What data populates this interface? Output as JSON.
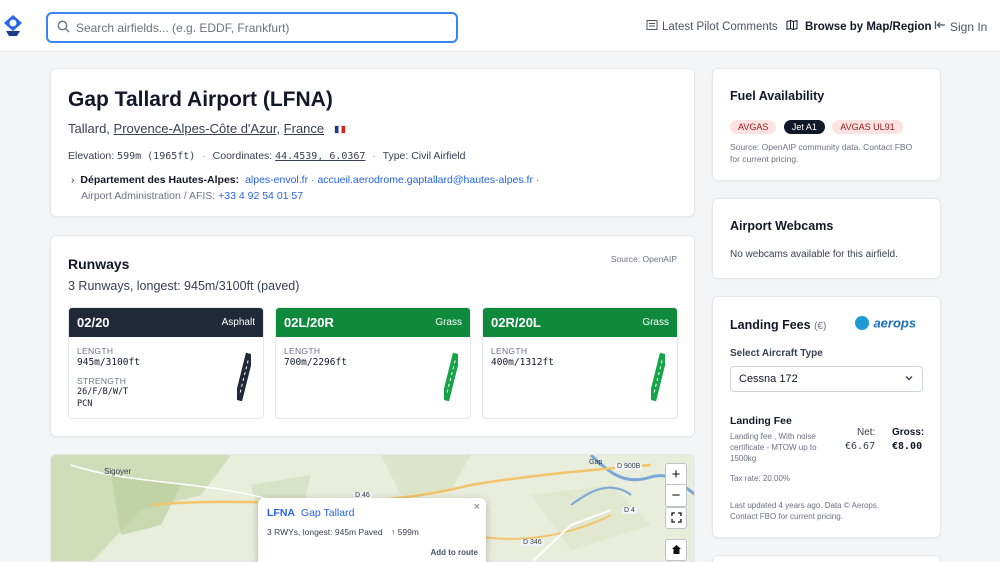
{
  "header": {
    "search_placeholder": "Search airfields... (e.g. EDDF, Frankfurt)",
    "latest_comments": "Latest Pilot Comments",
    "browse": "Browse by Map/Region",
    "sign_in": "Sign In"
  },
  "airport": {
    "title": "Gap Tallard Airport (LFNA)",
    "city": "Tallard",
    "region": "Provence-Alpes-Côte d'Azur",
    "country": "France",
    "elevation_label": "Elevation:",
    "elevation_value": "599m (1965ft)",
    "coordinates_label": "Coordinates:",
    "coordinates_value": "44.4539, 6.0367",
    "type_label": "Type:",
    "type_value": "Civil Airfield",
    "operator": "Département des Hautes-Alpes:",
    "website": "alpes-envol.fr",
    "email": "accueil.aerodrome.gaptallard@hautes-alpes.fr",
    "admin_label": "Airport Administration / AFIS:",
    "phone": "+33 4 92 54 01 57"
  },
  "runways": {
    "title": "Runways",
    "source": "Source: OpenAIP",
    "summary": "3 Runways, longest: 945m/3100ft (paved)",
    "length_label": "LENGTH",
    "strength_label": "STRENGTH",
    "items": [
      {
        "designator": "02/20",
        "surface": "Asphalt",
        "length": "945m/3100ft",
        "strength": "26/F/B/W/T",
        "pcn": "PCN",
        "color": "#1f2937"
      },
      {
        "designator": "02L/20R",
        "surface": "Grass",
        "length": "700m/2296ft",
        "color": "#0f8a3c"
      },
      {
        "designator": "02R/20L",
        "surface": "Grass",
        "length": "400m/1312ft",
        "color": "#0f8a3c"
      }
    ]
  },
  "fuel": {
    "title": "Fuel Availability",
    "badges": [
      "AVGAS",
      "Jet A1",
      "AVGAS UL91"
    ],
    "note_line1": "Source: OpenAIP community data. Contact FBO",
    "note_line2": "for current pricing."
  },
  "webcams": {
    "title": "Airport Webcams",
    "empty": "No webcams available for this airfield."
  },
  "fees": {
    "title": "Landing Fees",
    "currency": "(€)",
    "brand": "aerops",
    "aircraft_label": "Select Aircraft Type",
    "aircraft_value": "Cessna 172",
    "fee_title": "Landing Fee",
    "fee_desc_1": "Landing fee , With noise",
    "fee_desc_2": "certificate - MTOW up to",
    "fee_desc_3": "1500kg",
    "net_label": "Net:",
    "net_value": "€6.67",
    "gross_label": "Gross:",
    "gross_value": "€8.00",
    "tax": "Tax rate: 20.00%",
    "updated_1": "Last updated 4 years ago. Data © Aerops.",
    "updated_2": "Contact FBO for current pricing."
  },
  "map": {
    "labels": [
      "Sigoyer",
      "D 46",
      "D 900B",
      "D 4",
      "D 346",
      "Gap"
    ],
    "popup": {
      "code": "LFNA",
      "name": "Gap Tallard",
      "info": "3 RWYs, longest: 945m Paved",
      "elevation": "599m",
      "add": "Add to route"
    }
  }
}
